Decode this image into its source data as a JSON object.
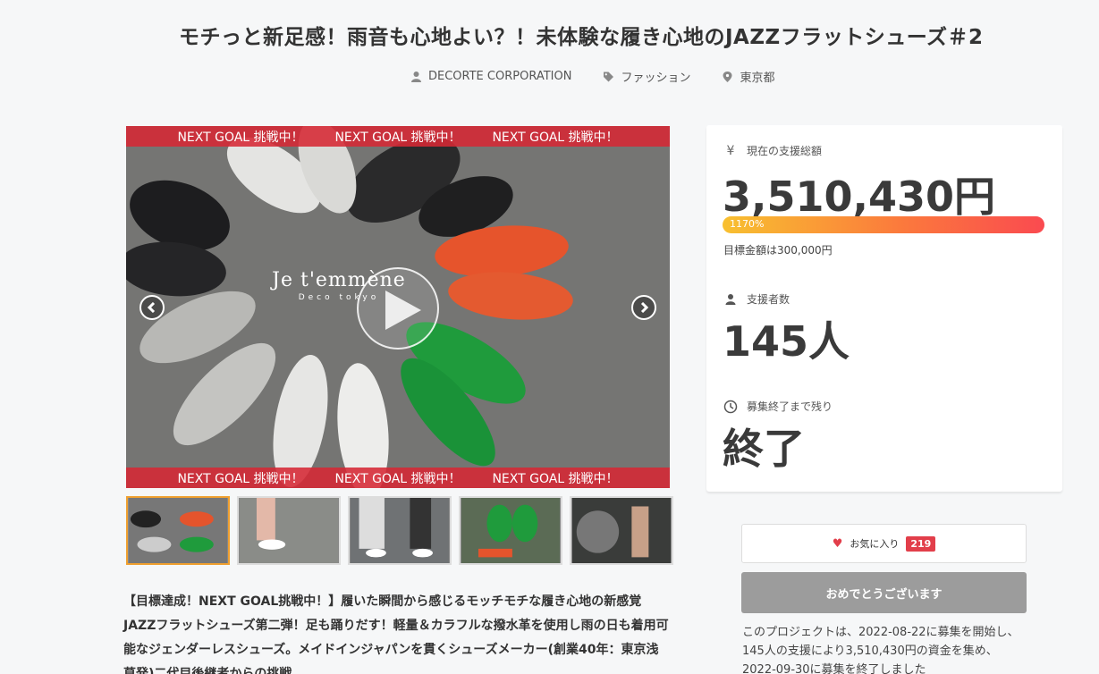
{
  "project": {
    "title": "モチっと新足感！雨音も心地よい？！未体験な履き心地のJAZZフラットシューズ＃2",
    "owner": "DECORTE CORPORATION",
    "category": "ファッション",
    "location": "東京都"
  },
  "gallery": {
    "banner_text": "NEXT GOAL 挑戦中！",
    "brand_name": "Je t'emmène",
    "brand_sub": "Deco tokyo",
    "thumbnails": 5,
    "active_thumbnail": 1
  },
  "description": "【目標達成！NEXT GOAL挑戦中！】履いた瞬間から感じるモッチモチな履き心地の新感覚JAZZフラットシューズ第二弾！足も踊りだす！軽量＆カラフルな撥水革を使用し雨の日も着用可能なジェンダーレスシューズ。メイドインジャパンを貫くシューズメーカー(創業40年：東京浅草発)二代目後継者からの挑戦。",
  "stats": {
    "total_label": "現在の支援総額",
    "total_value": "3,510,430円",
    "progress_text": "1170%",
    "progress_percent": 1170,
    "goal_text": "目標金額は300,000円",
    "supporters_label": "支援者数",
    "supporters_value": "145人",
    "remaining_label": "募集終了まで残り",
    "remaining_value": "終了"
  },
  "actions": {
    "favorite_label": "お気に入り",
    "favorite_count": "219",
    "congrats_label": "おめでとうございます"
  },
  "summary": "このプロジェクトは、2022-08-22に募集を開始し、145人の支援により3,510,430円の資金を集め、2022-09-30に募集を終了しました",
  "colors": {
    "banner": "#d62834",
    "progress_start": "#f8c030",
    "progress_end": "#fa4a50",
    "favorite": "#e23e4a",
    "disabled_button": "#9c9c9c"
  }
}
